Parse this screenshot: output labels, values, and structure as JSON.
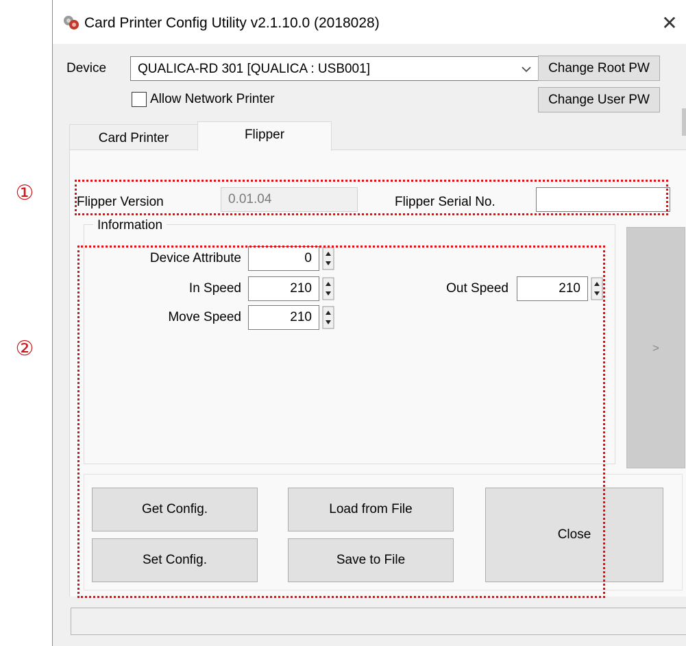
{
  "window": {
    "title": "Card Printer Config Utility v2.1.10.0 (2018028)"
  },
  "device": {
    "label": "Device",
    "selected": "QUALICA-RD 301 [QUALICA : USB001]",
    "allow_network_label": "Allow Network Printer",
    "allow_network_checked": false,
    "change_root_pw": "Change Root PW",
    "change_user_pw": "Change User PW"
  },
  "tabs": [
    {
      "label": "Card Printer",
      "active": false
    },
    {
      "label": "Flipper",
      "active": true
    }
  ],
  "flipper": {
    "version_label": "Flipper Version",
    "version_value": "0.01.04",
    "serial_label": "Flipper Serial No.",
    "serial_value": ""
  },
  "information": {
    "group_label": "Information",
    "device_attribute_label": "Device Attribute",
    "device_attribute_value": "0",
    "in_speed_label": "In Speed",
    "in_speed_value": "210",
    "move_speed_label": "Move Speed",
    "move_speed_value": "210",
    "out_speed_label": "Out Speed",
    "out_speed_value": "210",
    "next_button": ">"
  },
  "actions": {
    "get_config": "Get Config.",
    "set_config": "Set Config.",
    "load_from_file": "Load from File",
    "save_to_file": "Save to File",
    "close": "Close"
  },
  "annotations": {
    "marker_1": "①",
    "marker_2": "②"
  },
  "colors": {
    "annotation": "#d0151a",
    "window_bg": "#f0f0f0",
    "button_bg": "#e1e1e1"
  }
}
